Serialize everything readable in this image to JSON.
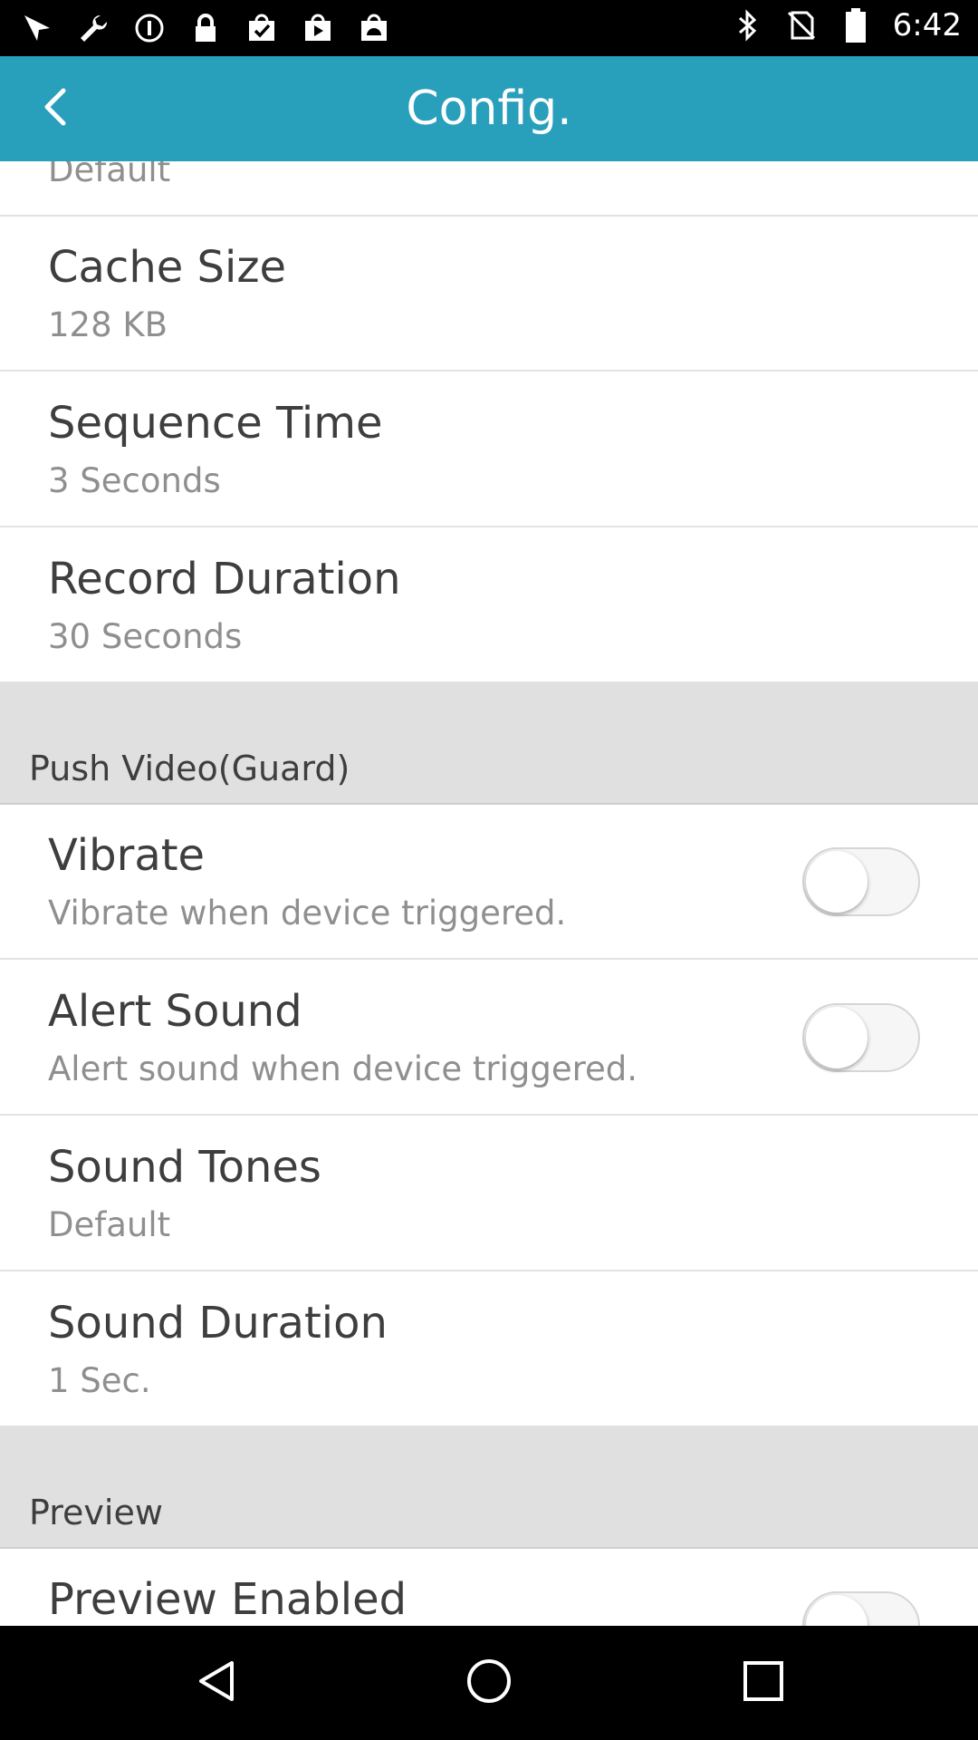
{
  "status_bar": {
    "time": "6:42",
    "left_icons": [
      "fake-gps-icon",
      "wrench-icon",
      "circle-info-icon",
      "lock-icon",
      "checkmark-bag-icon",
      "play-bag-icon",
      "android-bag-icon"
    ],
    "right_icons": [
      "bluetooth-icon",
      "no-sim-icon",
      "battery-icon"
    ]
  },
  "app_bar": {
    "title": "Config.",
    "back_icon": "back-arrow-icon"
  },
  "list": {
    "partial_top_value": "Default",
    "rows_a": [
      {
        "title": "Cache Size",
        "value": "128 KB"
      },
      {
        "title": "Sequence Time",
        "value": "3 Seconds"
      },
      {
        "title": "Record Duration",
        "value": "30 Seconds"
      }
    ],
    "section_push": "Push Video(Guard)",
    "rows_b": [
      {
        "title": "Vibrate",
        "value": "Vibrate when device triggered.",
        "toggle": false
      },
      {
        "title": "Alert Sound",
        "value": "Alert sound when device triggered.",
        "toggle": false
      },
      {
        "title": "Sound Tones",
        "value": "Default"
      },
      {
        "title": "Sound Duration",
        "value": "1 Sec."
      }
    ],
    "section_preview": "Preview",
    "rows_c": [
      {
        "title": "Preview Enabled",
        "toggle": false
      }
    ]
  },
  "nav_bar": {
    "icons": [
      "nav-back-icon",
      "nav-home-icon",
      "nav-recents-icon"
    ]
  }
}
